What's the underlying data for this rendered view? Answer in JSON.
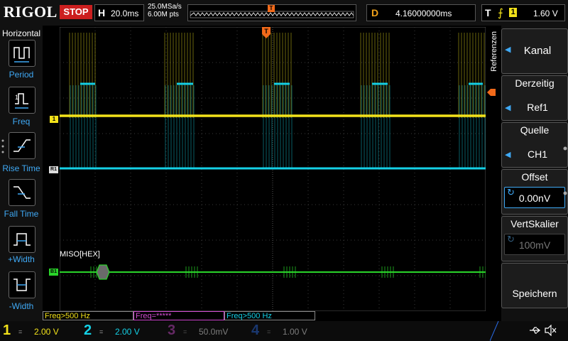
{
  "colors": {
    "ch1": "#f2e21a",
    "ch2": "#14d1e6",
    "ch3": "#d24cd2",
    "ch4": "#2a6ce8",
    "bus": "#2ad42a",
    "stop": "#cc1f1f",
    "accent": "#f2a21a"
  },
  "top": {
    "logo": "RIGOL",
    "run_state": "STOP",
    "timebase_label": "H",
    "timebase_value": "20.0ms",
    "sample_rate": "25.0MSa/s",
    "memory_depth": "6.00M pts",
    "trigger_marker": "T",
    "delay_label": "D",
    "delay_value": "4.16000000ms",
    "trigger_label": "T",
    "trigger_source": "1",
    "trigger_level": "1.60 V"
  },
  "left_menu": {
    "title": "Horizontal",
    "buttons": [
      {
        "label": "Period",
        "icon": "period-icon"
      },
      {
        "label": "Freq",
        "icon": "frequency-icon"
      },
      {
        "label": "Rise Time",
        "icon": "rise-time-icon"
      },
      {
        "label": "Fall Time",
        "icon": "fall-time-icon"
      },
      {
        "label": "+Width",
        "icon": "positive-width-icon"
      },
      {
        "label": "-Width",
        "icon": "negative-width-icon"
      }
    ]
  },
  "right_menu": {
    "vertical_label": "Referenzen",
    "items": [
      {
        "title": "",
        "value": "Kanal"
      },
      {
        "title": "Derzeitig",
        "value": "Ref1"
      },
      {
        "title": "Quelle",
        "value": "CH1"
      },
      {
        "title": "Offset",
        "value": "0.00nV"
      },
      {
        "title": "VertSkalier",
        "value": "100mV"
      },
      {
        "title": "",
        "value": "Speichern"
      }
    ]
  },
  "waveform": {
    "ch1_marker": "1",
    "ref_marker": "R1",
    "bus_marker": "B1",
    "bus_label": "MISO[HEX]"
  },
  "freq_readouts": [
    "Freq>500 Hz",
    "Freq=*****",
    "Freq>500 Hz"
  ],
  "channels": [
    {
      "num": "1",
      "coupling": "=",
      "scale": "2.00 V"
    },
    {
      "num": "2",
      "coupling": "=",
      "scale": "2.00 V"
    },
    {
      "num": "3",
      "coupling": "=",
      "scale": "50.0mV"
    },
    {
      "num": "4",
      "coupling": "=",
      "scale": "1.00 V"
    }
  ],
  "status_icons": [
    "usb-icon",
    "mute-icon"
  ]
}
